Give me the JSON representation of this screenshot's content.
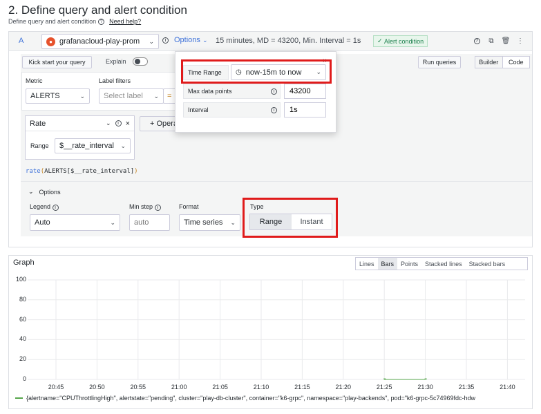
{
  "page": {
    "title": "2. Define query and alert condition",
    "subtitle": "Define query and alert condition",
    "help_link": "Need help?"
  },
  "query": {
    "ref_id": "A",
    "datasource": "grafanacloud-play-prom",
    "options_label": "Options",
    "options_summary": "15 minutes, MD = 43200, Min. Interval = 1s",
    "alert_badge": "Alert condition"
  },
  "toolbar": {
    "kick_start": "Kick start your query",
    "explain": "Explain",
    "run_queries": "Run queries",
    "builder": "Builder",
    "code": "Code"
  },
  "builder": {
    "metric_label": "Metric",
    "metric_value": "ALERTS",
    "label_filters_label": "Label filters",
    "label_placeholder": "Select label",
    "operator": "=",
    "operation_name": "Rate",
    "range_label": "Range",
    "range_value": "$__rate_interval",
    "add_operation": "Operations",
    "query_preview": {
      "fn": "rate",
      "open": "(",
      "args": "ALERTS[$__rate_interval]",
      "close": ")"
    }
  },
  "options_section": {
    "title": "Options",
    "legend_label": "Legend",
    "legend_value": "Auto",
    "min_step_label": "Min step",
    "min_step_placeholder": "auto",
    "format_label": "Format",
    "format_value": "Time series",
    "type_label": "Type",
    "type_range": "Range",
    "type_instant": "Instant"
  },
  "popover": {
    "time_range_label": "Time Range",
    "time_range_value": "now-15m to now",
    "max_data_points_label": "Max data points",
    "max_data_points_value": "43200",
    "interval_label": "Interval",
    "interval_value": "1s"
  },
  "graph": {
    "title": "Graph",
    "viz_options": [
      "Lines",
      "Bars",
      "Points",
      "Stacked lines",
      "Stacked bars"
    ],
    "viz_selected": "Bars",
    "legend_entry": "{alertname=\"CPUThrottlingHigh\", alertstate=\"pending\", cluster=\"play-db-cluster\", container=\"k6-grpc\", namespace=\"play-backends\", pod=\"k6-grpc-5c74969fdc-hdw"
  },
  "chart_data": {
    "type": "bar",
    "title": "",
    "xlabel": "",
    "ylabel": "",
    "x_ticks": [
      "20:45",
      "20:50",
      "20:55",
      "21:00",
      "21:05",
      "21:10",
      "21:15",
      "21:20",
      "21:25",
      "21:30",
      "21:35",
      "21:40"
    ],
    "y_ticks": [
      0,
      20,
      40,
      60,
      80,
      100
    ],
    "ylim": [
      0,
      100
    ],
    "grid": true,
    "series": [
      {
        "name": "{alertname=\"CPUThrottlingHigh\", alertstate=\"pending\", cluster=\"play-db-cluster\", container=\"k6-grpc\", namespace=\"play-backends\", pod=\"k6-grpc-5c74969fdc-hdw",
        "color": "#56a64b",
        "x": [
          "21:25",
          "21:30"
        ],
        "values": [
          1,
          1
        ]
      }
    ]
  },
  "colors": {
    "accent": "#3d71d9",
    "highlight": "#e01b1b",
    "series": "#56a64b"
  }
}
